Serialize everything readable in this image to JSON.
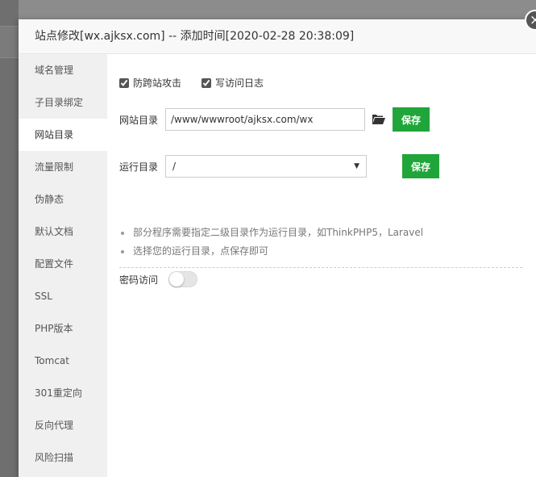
{
  "dialog": {
    "title": "站点修改[wx.ajksx.com] -- 添加时间[2020-02-28 20:38:09]",
    "close_glyph": "×"
  },
  "sidebar": {
    "items": [
      {
        "label": "域名管理",
        "active": false
      },
      {
        "label": "子目录绑定",
        "active": false
      },
      {
        "label": "网站目录",
        "active": true
      },
      {
        "label": "流量限制",
        "active": false
      },
      {
        "label": "伪静态",
        "active": false
      },
      {
        "label": "默认文档",
        "active": false
      },
      {
        "label": "配置文件",
        "active": false
      },
      {
        "label": "SSL",
        "active": false
      },
      {
        "label": "PHP版本",
        "active": false
      },
      {
        "label": "Tomcat",
        "active": false
      },
      {
        "label": "301重定向",
        "active": false
      },
      {
        "label": "反向代理",
        "active": false
      },
      {
        "label": "风险扫描",
        "active": false
      }
    ]
  },
  "options": {
    "anti_cross_site": {
      "label": "防跨站攻击",
      "checked": true
    },
    "access_log": {
      "label": "写访问日志",
      "checked": true
    }
  },
  "site_dir": {
    "label": "网站目录",
    "value": "/www/wwwroot/ajksx.com/wx",
    "folder_icon": "folder-open-icon",
    "save_label": "保存"
  },
  "run_dir": {
    "label": "运行目录",
    "selected": "/",
    "save_label": "保存"
  },
  "tips": [
    "部分程序需要指定二级目录作为运行目录，如ThinkPHP5，Laravel",
    "选择您的运行目录，点保存即可"
  ],
  "password_access": {
    "label": "密码访问",
    "enabled": false
  },
  "colors": {
    "primary_green": "#20a53a",
    "sidebar_bg": "#f0f0f0",
    "overlay": "#8c8c8c"
  }
}
